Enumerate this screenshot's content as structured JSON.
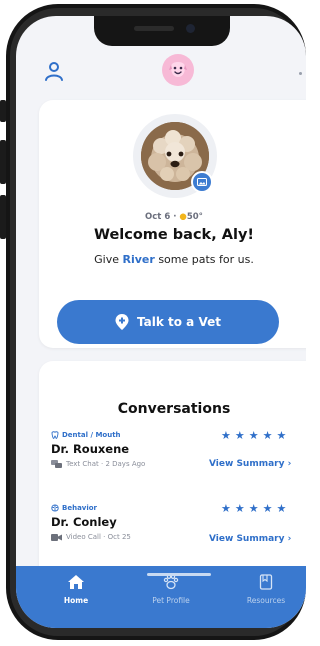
{
  "header": {
    "profile_icon": "user-icon",
    "logo_icon": "dog-face-logo"
  },
  "welcome": {
    "date": "Oct 6",
    "separator": "·",
    "weather_icon": "sun-icon",
    "temperature": "50°",
    "title": "Welcome back, Aly!",
    "message_prefix": "Give",
    "pet_name": "River",
    "message_suffix": "some pats for us.",
    "cta_label": "Talk to a Vet"
  },
  "conversations": {
    "title": "Conversations",
    "items": [
      {
        "category": "Dental / Mouth",
        "category_icon": "tooth-icon",
        "doctor": "Dr. Rouxene",
        "channel_icon": "chat-bubbles-icon",
        "channel": "Text Chat",
        "sep": "·",
        "when": "2 Days Ago",
        "rating": 5,
        "rating_text": "★★★★★",
        "action": "View Summary ›"
      },
      {
        "category": "Behavior",
        "category_icon": "brain-icon",
        "doctor": "Dr. Conley",
        "channel_icon": "video-camera-icon",
        "channel": "Video Call",
        "sep": "·",
        "when": "Oct 25",
        "rating": 5,
        "rating_text": "★★★★★",
        "action": "View Summary ›"
      }
    ]
  },
  "tabbar": {
    "items": [
      {
        "label": "Home",
        "icon": "home-icon",
        "active": true
      },
      {
        "label": "Pet Profile",
        "icon": "paw-icon",
        "active": false
      },
      {
        "label": "Resources",
        "icon": "book-icon",
        "active": false
      }
    ]
  },
  "colors": {
    "accent": "#3a79cf",
    "logo_bg": "#f7b9d6",
    "background": "#f3f4f8"
  }
}
